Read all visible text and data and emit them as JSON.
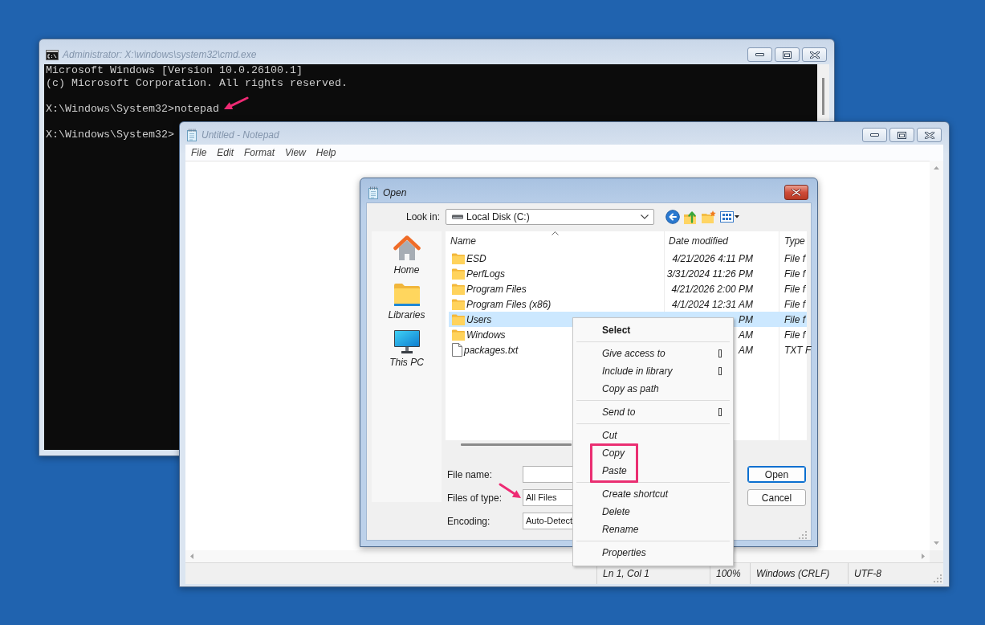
{
  "console_window": {
    "title": "Administrator: X:\\windows\\system32\\cmd.exe",
    "active": false,
    "blocks": [
      {
        "lines": [
          "Microsoft Windows [Version 10.0.26100.1]",
          "(c) Microsoft Corporation. All rights reserved."
        ],
        "arrow": false
      },
      {
        "lines": [
          "X:\\Windows\\System32>notepad"
        ],
        "arrow": true
      },
      {
        "lines": [
          "X:\\Windows\\System32>"
        ],
        "arrow": false
      }
    ]
  },
  "notepad_window": {
    "title": "Untitled - Notepad",
    "active": false,
    "menu": [
      "File",
      "Edit",
      "Format",
      "View",
      "Help"
    ],
    "status_bar": [
      "Ln 1, Col 1",
      "100%",
      "Windows (CRLF)",
      "UTF-8"
    ]
  },
  "open_dialog": {
    "title": "Open",
    "active": true,
    "look_in": {
      "label": "Look in:",
      "value": "Local Disk (C:)"
    },
    "places": [
      {
        "label": "Home",
        "kind": "home"
      },
      {
        "label": "Libraries",
        "kind": "libraries"
      },
      {
        "label": "This PC",
        "kind": "computer"
      }
    ],
    "columns": [
      {
        "label": "Name",
        "sorted": true
      },
      {
        "label": "Date modified",
        "sorted": false
      },
      {
        "label": "Type",
        "sorted": false
      }
    ],
    "rows": [
      {
        "name": "ESD",
        "date": "4/21/2026 4:11 PM",
        "type": "File f",
        "kind": "folder",
        "selected": false
      },
      {
        "name": "PerfLogs",
        "date": "3/31/2024 11:26 PM",
        "type": "File f",
        "kind": "folder",
        "selected": false
      },
      {
        "name": "Program Files",
        "date": "4/21/2026 2:00 PM",
        "type": "File f",
        "kind": "folder",
        "selected": false
      },
      {
        "name": "Program Files (x86)",
        "date": "4/1/2024 12:31 AM",
        "type": "File f",
        "kind": "folder",
        "selected": false
      },
      {
        "name": "Users",
        "date": "PM",
        "type": "File f",
        "kind": "folder",
        "selected": true
      },
      {
        "name": "Windows",
        "date": "AM",
        "type": "File f",
        "kind": "folder",
        "selected": false
      },
      {
        "name": "packages.txt",
        "date": "AM",
        "type": "TXT F",
        "kind": "file",
        "selected": false
      }
    ],
    "fields": [
      {
        "label": "File name:",
        "arrow": false
      },
      {
        "label": "Files of type:",
        "value": "All Files",
        "arrow": true
      },
      {
        "label": "Encoding:",
        "value": "Auto-Detect",
        "arrow": false
      }
    ],
    "buttons": [
      {
        "label": "Open",
        "default": true
      },
      {
        "label": "Cancel",
        "default": false
      }
    ]
  },
  "context_menu": {
    "sections": [
      {
        "items": [
          {
            "label": "Select",
            "default": true,
            "submenu": false,
            "highlighted": false
          }
        ]
      },
      {
        "items": [
          {
            "label": "Give access to",
            "default": false,
            "submenu": true,
            "highlighted": false
          },
          {
            "label": "Include in library",
            "default": false,
            "submenu": true,
            "highlighted": false
          },
          {
            "label": "Copy as path",
            "default": false,
            "submenu": false,
            "highlighted": false
          }
        ]
      },
      {
        "items": [
          {
            "label": "Send to",
            "default": false,
            "submenu": true,
            "highlighted": false
          }
        ]
      },
      {
        "items": [
          {
            "label": "Cut",
            "default": false,
            "submenu": false,
            "highlighted": false
          },
          {
            "label": "Copy",
            "default": false,
            "submenu": false,
            "highlighted": true
          },
          {
            "label": "Paste",
            "default": false,
            "submenu": false,
            "highlighted": true
          }
        ]
      },
      {
        "items": [
          {
            "label": "Create shortcut",
            "default": false,
            "submenu": false,
            "highlighted": false
          },
          {
            "label": "Delete",
            "default": false,
            "submenu": false,
            "highlighted": false
          },
          {
            "label": "Rename",
            "default": false,
            "submenu": false,
            "highlighted": false
          }
        ]
      },
      {
        "items": [
          {
            "label": "Properties",
            "default": false,
            "submenu": false,
            "highlighted": false
          }
        ]
      }
    ]
  }
}
